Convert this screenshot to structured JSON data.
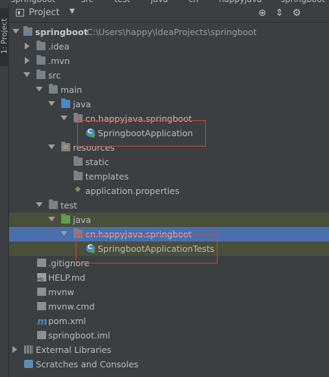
{
  "top_crumbs": [
    "springboot",
    "src",
    "test",
    "java",
    "cn",
    "happyjava",
    "springboot"
  ],
  "sidebar": {
    "tab_label": "1: Project"
  },
  "header": {
    "title": "Project",
    "caret": "▼",
    "buttons": [
      {
        "icon": "crosshair-icon",
        "glyph": "⊕"
      },
      {
        "icon": "collapse-icon",
        "glyph": "⇕"
      },
      {
        "icon": "gear-icon",
        "glyph": "⚙"
      }
    ]
  },
  "tree": [
    {
      "label": "springboot",
      "extra": "C:\\Users\\happy\\IdeaProjects\\springboot",
      "type": "module",
      "state": "open"
    },
    {
      "label": ".idea",
      "type": "folder",
      "state": "closed"
    },
    {
      "label": ".mvn",
      "type": "folder",
      "state": "closed"
    },
    {
      "label": "src",
      "type": "folder",
      "state": "open"
    },
    {
      "label": "main",
      "type": "folder",
      "state": "open"
    },
    {
      "label": "java",
      "type": "source-folder",
      "state": "open"
    },
    {
      "label": "cn.happyjava.springboot",
      "type": "package",
      "state": "open"
    },
    {
      "label": "SpringbootApplication",
      "type": "class"
    },
    {
      "label": "resources",
      "type": "resources-folder",
      "state": "open"
    },
    {
      "label": "static",
      "type": "folder"
    },
    {
      "label": "templates",
      "type": "folder"
    },
    {
      "label": "application.properties",
      "type": "properties"
    },
    {
      "label": "test",
      "type": "folder",
      "state": "open"
    },
    {
      "label": "java",
      "type": "test-folder",
      "state": "open"
    },
    {
      "label": "cn.happyjava.springboot",
      "type": "package",
      "state": "open"
    },
    {
      "label": "SpringbootApplicationTests",
      "type": "class"
    },
    {
      "label": ".gitignore",
      "type": "file"
    },
    {
      "label": "HELP.md",
      "type": "markdown"
    },
    {
      "label": "mvnw",
      "type": "file"
    },
    {
      "label": "mvnw.cmd",
      "type": "file"
    },
    {
      "label": "pom.xml",
      "type": "maven"
    },
    {
      "label": "springboot.iml",
      "type": "file"
    },
    {
      "label": "External Libraries",
      "type": "libraries",
      "state": "closed"
    },
    {
      "label": "Scratches and Consoles",
      "type": "scratches"
    }
  ],
  "colors": {
    "panel_bg": "#3c3f41",
    "selected_row": "#4b6eaf",
    "highlight_row": "#4a4f3c",
    "annotation_box": "#d64545"
  }
}
